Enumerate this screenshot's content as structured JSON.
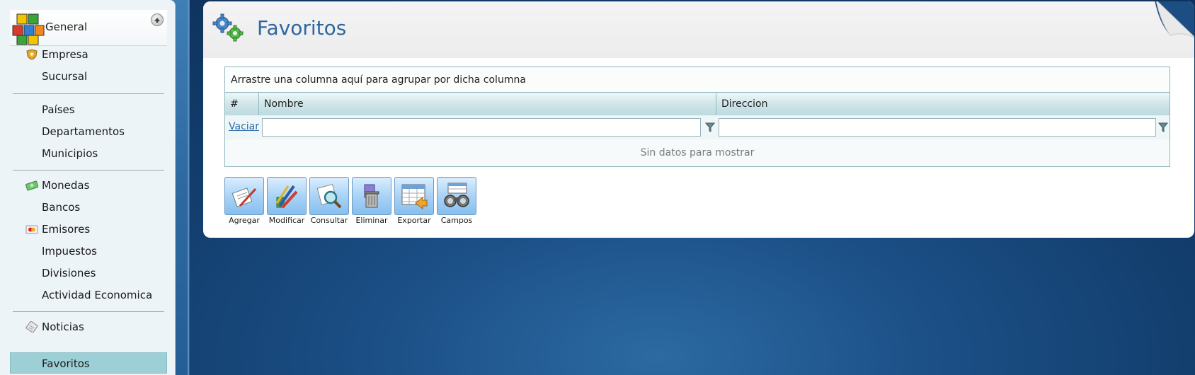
{
  "sidebar": {
    "header": {
      "label": "General"
    },
    "groups": [
      {
        "items": [
          {
            "label": "Empresa",
            "icon": "shield-icon"
          },
          {
            "label": "Sucursal"
          }
        ]
      },
      {
        "items": [
          {
            "label": "Países"
          },
          {
            "label": "Departamentos"
          },
          {
            "label": "Municipios"
          }
        ]
      },
      {
        "items": [
          {
            "label": "Monedas",
            "icon": "money-icon"
          },
          {
            "label": "Bancos"
          },
          {
            "label": "Emisores",
            "icon": "credit-card-icon"
          },
          {
            "label": "Impuestos"
          },
          {
            "label": "Divisiones"
          },
          {
            "label": "Actividad Economica"
          }
        ]
      },
      {
        "items": [
          {
            "label": "Noticias",
            "icon": "news-icon"
          },
          {
            "label": "Favoritos",
            "selected": true
          }
        ]
      }
    ]
  },
  "main": {
    "title": "Favoritos",
    "grid": {
      "group_panel_text": "Arrastre una columna aquí para agrupar por dicha columna",
      "columns": [
        {
          "label": "#"
        },
        {
          "label": "Nombre"
        },
        {
          "label": "Direccion"
        }
      ],
      "filter": {
        "clear_label": "Vaciar",
        "nombre_value": "",
        "direccion_value": ""
      },
      "empty_text": "Sin datos para mostrar"
    },
    "toolbar": [
      {
        "label": "Agregar",
        "icon": "add-document-icon"
      },
      {
        "label": "Modificar",
        "icon": "pencils-icon"
      },
      {
        "label": "Consultar",
        "icon": "magnifier-icon"
      },
      {
        "label": "Eliminar",
        "icon": "trash-can-icon"
      },
      {
        "label": "Exportar",
        "icon": "spreadsheet-export-icon"
      },
      {
        "label": "Campos",
        "icon": "binoculars-icon"
      }
    ]
  },
  "colors": {
    "accent": "#2e67a0",
    "selected_item": "#9ccfd6",
    "grid_border": "#8fb6bd",
    "desktop": "#123d6c"
  }
}
